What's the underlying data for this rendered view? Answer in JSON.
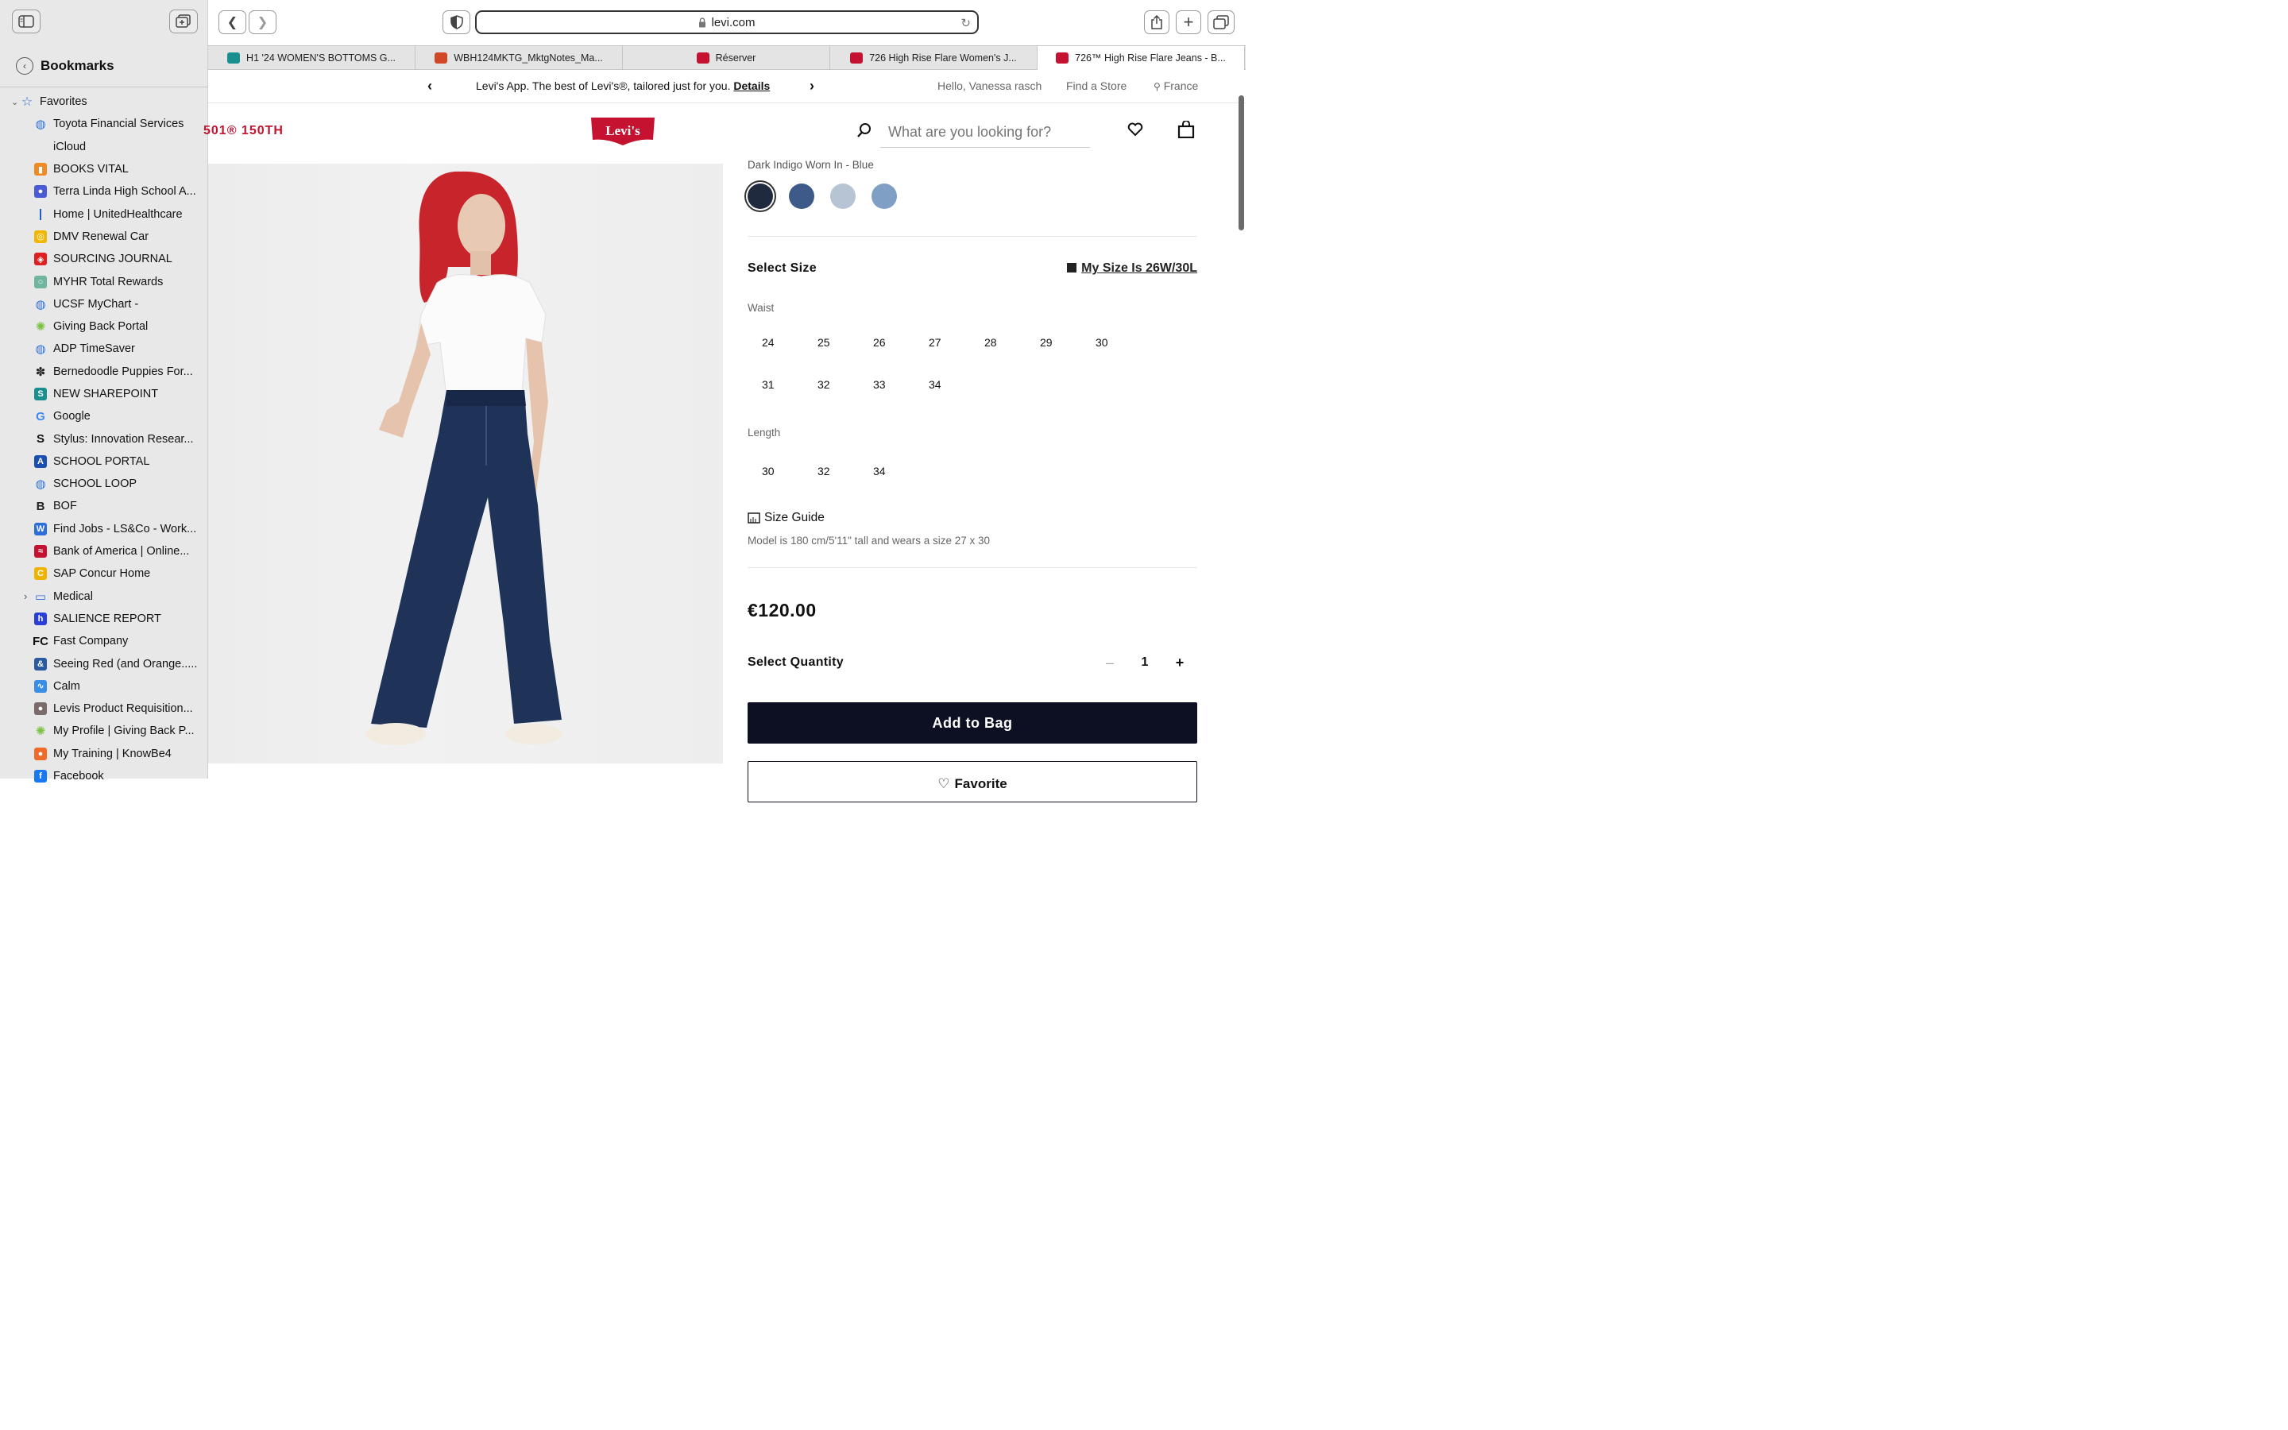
{
  "sidebar": {
    "title": "Bookmarks",
    "favorites_label": "Favorites",
    "items": [
      {
        "label": "Toyota Financial Services",
        "icon": "globe-icon",
        "color": "#2c6fd6"
      },
      {
        "label": "iCloud",
        "icon": "apple-icon",
        "color": "#888888"
      },
      {
        "label": "BOOKS VITAL",
        "icon": "book-icon",
        "color": "#f08a24"
      },
      {
        "label": "Terra Linda High School A...",
        "icon": "dots-icon",
        "color": "#4a5bd6"
      },
      {
        "label": "Home | UnitedHealthcare",
        "icon": "uhc-icon",
        "color": "#1a56c4"
      },
      {
        "label": "DMV Renewal Car",
        "icon": "dmv-icon",
        "color": "#f2b705"
      },
      {
        "label": "SOURCING JOURNAL",
        "icon": "journal-icon",
        "color": "#e02020"
      },
      {
        "label": "MYHR Total Rewards",
        "icon": "myhr-icon",
        "color": "#6fb5a0"
      },
      {
        "label": "UCSF MyChart -",
        "icon": "globe-icon",
        "color": "#2c6fd6"
      },
      {
        "label": "Giving Back Portal",
        "icon": "starburst-icon",
        "color": "#7cc242"
      },
      {
        "label": "ADP TimeSaver",
        "icon": "globe-icon",
        "color": "#2c6fd6"
      },
      {
        "label": "Bernedoodle Puppies For...",
        "icon": "paw-icon",
        "color": "#222222"
      },
      {
        "label": "NEW SHAREPOINT",
        "icon": "sharepoint-icon",
        "color": "#1a8f8f"
      },
      {
        "label": "Google",
        "icon": "google-icon",
        "color": "#4285f4"
      },
      {
        "label": "Stylus: Innovation Resear...",
        "icon": "stylus-icon",
        "color": "#111111"
      },
      {
        "label": "SCHOOL PORTAL",
        "icon": "school-portal-icon",
        "color": "#1a4fb0"
      },
      {
        "label": "SCHOOL LOOP",
        "icon": "globe-icon",
        "color": "#2c6fd6"
      },
      {
        "label": "BOF",
        "icon": "bof-icon",
        "color": "#222222"
      },
      {
        "label": "Find Jobs - LS&Co - Work...",
        "icon": "workday-icon",
        "color": "#2c6fd6"
      },
      {
        "label": "Bank of America | Online...",
        "icon": "boa-icon",
        "color": "#c41230"
      },
      {
        "label": "SAP Concur Home",
        "icon": "concur-icon",
        "color": "#f0b400"
      },
      {
        "label": "Medical",
        "icon": "folder-icon",
        "color": "#2c6fd6"
      },
      {
        "label": "SALIENCE REPORT",
        "icon": "salience-icon",
        "color": "#2b3fd6"
      },
      {
        "label": "Fast Company",
        "icon": "fc-icon",
        "color": "#111111"
      },
      {
        "label": "Seeing Red (and Orange.....",
        "icon": "ampersand-icon",
        "color": "#2c5aa0"
      },
      {
        "label": "Calm",
        "icon": "calm-icon",
        "color": "#3a8ee6"
      },
      {
        "label": "Levis Product Requisition...",
        "icon": "levis-icon",
        "color": "#7a6a6a"
      },
      {
        "label": "My Profile | Giving Back P...",
        "icon": "starburst-icon",
        "color": "#7cc242"
      },
      {
        "label": "My Training | KnowBe4",
        "icon": "knowbe4-icon",
        "color": "#f06a2a"
      },
      {
        "label": "Facebook",
        "icon": "facebook-icon",
        "color": "#1877f2"
      }
    ]
  },
  "browser": {
    "url": "levi.com",
    "tabs": [
      {
        "label": "H1 '24 WOMEN'S BOTTOMS G...",
        "color": "#1a8f8f"
      },
      {
        "label": "WBH124MKTG_MktgNotes_Ma...",
        "color": "#d24726"
      },
      {
        "label": "Réserver",
        "color": "#c41230"
      },
      {
        "label": "726 High Rise Flare Women's J...",
        "color": "#c41230"
      },
      {
        "label": "726™ High Rise Flare Jeans - B...",
        "color": "#c41230"
      }
    ]
  },
  "promo": {
    "message": "Levi's App. The best of Levi's®, tailored just for you.",
    "details_link": "Details",
    "greeting": "Hello, Vanessa rasch",
    "find_store": "Find a Store",
    "country": "France"
  },
  "header": {
    "marquee": "501® 150TH",
    "logo_text": "Levi's",
    "search_placeholder": "What are you looking for?"
  },
  "product": {
    "color_name": "Dark Indigo Worn In - Blue",
    "swatch_colors": [
      "#1f2a3f",
      "#3e5a88",
      "#b7c4d4",
      "#7f9fc4"
    ],
    "select_size_label": "Select Size",
    "my_size": "My Size Is 26W/30L",
    "waist_label": "Waist",
    "waist_sizes": [
      "24",
      "25",
      "26",
      "27",
      "28",
      "29",
      "30",
      "31",
      "32",
      "33",
      "34"
    ],
    "length_label": "Length",
    "length_sizes": [
      "30",
      "32",
      "34"
    ],
    "size_guide": "Size Guide",
    "model_info": "Model is 180 cm/5'11\" tall and wears a size 27 x 30",
    "price": "€120.00",
    "select_quantity_label": "Select Quantity",
    "quantity": "1",
    "add_to_bag": "Add to Bag",
    "favorite": "Favorite"
  }
}
